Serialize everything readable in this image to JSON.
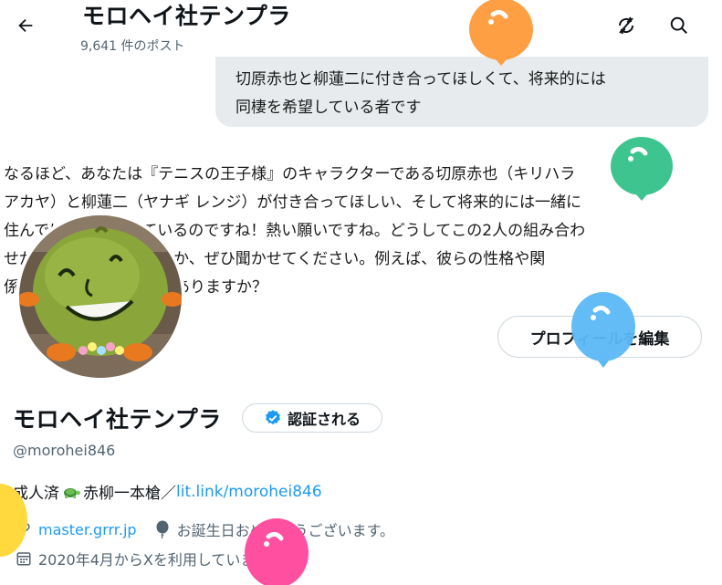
{
  "header": {
    "title": "モロヘイ社テンプラ",
    "post_count": "9,641 件のポスト"
  },
  "user_message": {
    "line1": "切原赤也と柳蓮二に付き合ってほしくて、将来的には",
    "line2": "同棲を希望している者です"
  },
  "ai_reply": {
    "line1": "なるほど、あなたは『テニスの王子様』のキャラクターである切原赤也（キリハラ",
    "line2": "アカヤ）と柳蓮二（ヤナギ レンジ）が付き合ってほしい、そして将来的には一緒に",
    "line3": "住んでほしいと思っているのですね！熱い願いですね。どうしてこの2人の組み合わ",
    "line4": "せが良いと思っているのか、ぜひ聞かせてください。例えば、彼らの性格や関",
    "line5": "係性で好きなところとかありますか？"
  },
  "profile": {
    "edit_button": "プロフィールを編集",
    "display_name": "モロヘイ社テンプラ",
    "verify_label": "認証される",
    "handle": "@morohei846",
    "bio_prefix": "成人済",
    "bio_middle": "赤柳一本槍／",
    "bio_link": "lit.link/morohei846",
    "website": "master.grrr.jp",
    "birthday": "お誕生日おめでとうございます。",
    "joined": "2020年4月からXを利用しています"
  },
  "icons": {
    "back": "back-arrow-icon",
    "rotate": "no-sync-icon",
    "search": "search-icon",
    "verified": "verified-badge-icon",
    "turtle": "turtle-emoji-icon",
    "link": "link-icon",
    "balloon": "balloon-icon",
    "calendar": "calendar-icon"
  },
  "colors": {
    "accent": "#1d9bf0",
    "muted": "#536471",
    "balloon_orange": "#ff9f43",
    "balloon_green": "#3ec48f",
    "balloon_blue": "#5bb8f5",
    "balloon_pink": "#ff4fa1",
    "balloon_yellow": "#ffd93d"
  }
}
